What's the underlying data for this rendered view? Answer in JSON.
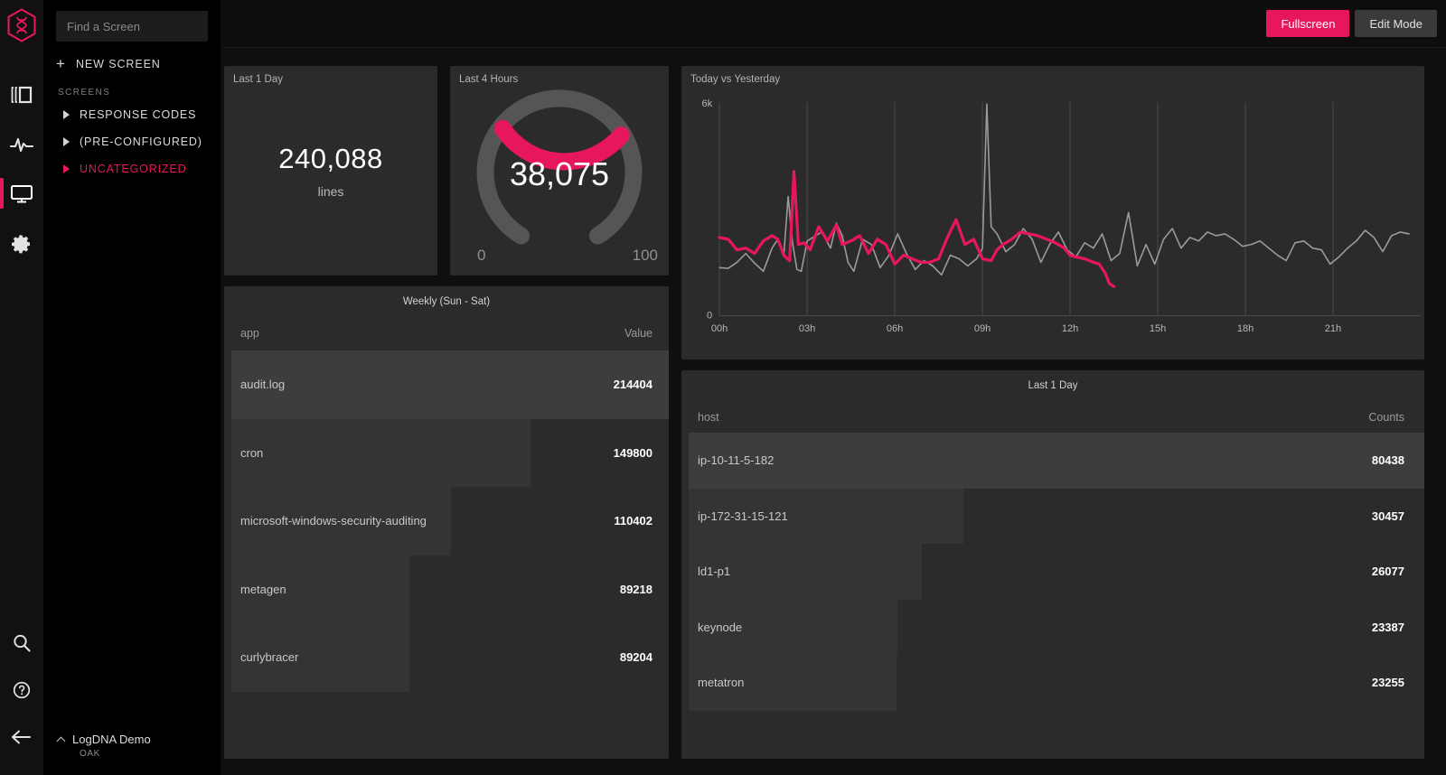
{
  "brand": {
    "accent": "#e8175d",
    "logo_icon": "dna-hexagon-logo"
  },
  "rail": {
    "items": [
      {
        "icon": "logs-view-icon",
        "name": "logs"
      },
      {
        "icon": "activity-pulse-icon",
        "name": "activity"
      },
      {
        "icon": "screen-monitor-icon",
        "name": "screens",
        "active": true
      },
      {
        "icon": "gear-icon",
        "name": "settings"
      }
    ],
    "bottom": [
      {
        "icon": "search-icon",
        "name": "search"
      },
      {
        "icon": "help-circle-icon",
        "name": "help"
      },
      {
        "icon": "collapse-arrow-left-icon",
        "name": "collapse"
      }
    ]
  },
  "sidebar": {
    "search": {
      "placeholder": "Find a Screen",
      "value": ""
    },
    "new_screen_label": "NEW SCREEN",
    "section_label": "SCREENS",
    "screens": [
      {
        "label": "RESPONSE CODES",
        "selected": false
      },
      {
        "label": "(PRE-CONFIGURED)",
        "selected": false
      },
      {
        "label": "UNCATEGORIZED",
        "selected": true
      }
    ],
    "org": {
      "name": "LogDNA Demo",
      "sub": "OAK"
    }
  },
  "topbar": {
    "fullscreen_label": "Fullscreen",
    "edit_mode_label": "Edit Mode"
  },
  "widgets": {
    "count": {
      "title": "Last 1 Day",
      "value": "240,088",
      "unit": "lines"
    },
    "gauge": {
      "title": "Last 4 Hours",
      "value": "38,075",
      "min": "0",
      "max": "100",
      "percent": 38
    },
    "apps": {
      "title": "Weekly (Sun - Sat)",
      "col_key": "app",
      "col_value": "Value",
      "rows": [
        {
          "key": "audit.log",
          "value": "214404",
          "pct": 100
        },
        {
          "key": "cron",
          "value": "149800",
          "pct": 69
        },
        {
          "key": "microsoft-windows-security-auditing",
          "value": "110402",
          "pct": 51
        },
        {
          "key": "metagen",
          "value": "89218",
          "pct": 41.6
        },
        {
          "key": "curlybracer",
          "value": "89204",
          "pct": 41.6
        }
      ]
    },
    "hosts": {
      "title": "Last 1 Day",
      "col_key": "host",
      "col_value": "Counts",
      "rows": [
        {
          "key": "ip-10-11-5-182",
          "value": "80438",
          "pct": 100
        },
        {
          "key": "ip-172-31-15-121",
          "value": "30457",
          "pct": 37.9
        },
        {
          "key": "ld1-p1",
          "value": "26077",
          "pct": 32.4
        },
        {
          "key": "keynode",
          "value": "23387",
          "pct": 29.1
        },
        {
          "key": "metatron",
          "value": "23255",
          "pct": 28.9
        }
      ]
    }
  },
  "chart_data": {
    "type": "line",
    "title": "Today vs Yesterday",
    "xlabel": "",
    "ylabel": "",
    "ylim": [
      0,
      6000
    ],
    "y_ticks": [
      "0",
      "6k"
    ],
    "grid": true,
    "legend": "none",
    "x_tick_labels": [
      "00h",
      "03h",
      "06h",
      "09h",
      "12h",
      "15h",
      "18h",
      "21h"
    ],
    "x_tick_hours": [
      0,
      3,
      6,
      9,
      12,
      15,
      18,
      21
    ],
    "series": [
      {
        "name": "Yesterday",
        "color": "#9a9a9a",
        "x": [
          0,
          0.3,
          0.6,
          0.9,
          1.2,
          1.5,
          1.8,
          2.0,
          2.2,
          2.35,
          2.5,
          2.65,
          2.8,
          3.0,
          3.2,
          3.5,
          3.8,
          4.0,
          4.2,
          4.4,
          4.6,
          4.9,
          5.2,
          5.5,
          5.8,
          6.1,
          6.4,
          6.7,
          7.0,
          7.3,
          7.6,
          7.9,
          8.2,
          8.5,
          8.8,
          9.0,
          9.15,
          9.3,
          9.5,
          9.8,
          10.1,
          10.4,
          10.7,
          11.0,
          11.3,
          11.6,
          11.9,
          12.2,
          12.5,
          12.8,
          13.1,
          13.4,
          13.7,
          14.0,
          14.3,
          14.6,
          14.9,
          15.2,
          15.5,
          15.8,
          16.1,
          16.4,
          16.7,
          17.0,
          17.3,
          17.6,
          17.9,
          18.2,
          18.5,
          18.8,
          19.1,
          19.4,
          19.7,
          20.0,
          20.3,
          20.6,
          20.9,
          21.2,
          21.5,
          21.8,
          22.1,
          22.4,
          22.7,
          23.0,
          23.3,
          23.6
        ],
        "y": [
          1350,
          1330,
          1500,
          1750,
          1480,
          1250,
          1900,
          2150,
          1700,
          3350,
          2050,
          1300,
          1250,
          2100,
          2200,
          2350,
          1900,
          2600,
          2250,
          1500,
          1250,
          2150,
          2000,
          1350,
          1700,
          2300,
          1750,
          1300,
          1550,
          1400,
          1150,
          1700,
          1600,
          1400,
          1600,
          1900,
          5950,
          2500,
          2300,
          1800,
          2000,
          2450,
          2150,
          1500,
          2000,
          2350,
          1850,
          1650,
          2050,
          1900,
          2300,
          1550,
          1750,
          2900,
          1400,
          2000,
          1450,
          2150,
          2450,
          1900,
          2200,
          2100,
          2350,
          2250,
          2300,
          2150,
          1950,
          2000,
          2100,
          1900,
          1700,
          1550,
          2050,
          2100,
          1900,
          1850,
          1450,
          1650,
          1900,
          2100,
          2400,
          2200,
          1800,
          2250,
          2350,
          2300
        ]
      },
      {
        "name": "Today",
        "color": "#e8175d",
        "x": [
          0,
          0.3,
          0.6,
          0.9,
          1.2,
          1.5,
          1.8,
          2.0,
          2.2,
          2.4,
          2.55,
          2.7,
          2.9,
          3.1,
          3.4,
          3.7,
          4.0,
          4.2,
          4.5,
          4.8,
          5.1,
          5.4,
          5.7,
          6.0,
          6.3,
          6.6,
          6.9,
          7.2,
          7.5,
          7.8,
          8.1,
          8.4,
          8.7,
          9.0,
          9.3,
          9.5,
          9.7,
          10.0,
          10.3,
          10.6,
          10.9,
          11.2,
          11.5,
          11.8,
          12.0,
          12.2,
          12.5,
          12.8,
          13.0,
          13.2,
          13.35,
          13.5
        ],
        "y": [
          2200,
          2150,
          1850,
          1900,
          1750,
          2100,
          2250,
          2150,
          1700,
          1550,
          4050,
          2000,
          2050,
          1850,
          2500,
          2100,
          2550,
          2000,
          2100,
          2250,
          1750,
          2150,
          2000,
          1450,
          1700,
          1600,
          1500,
          1500,
          1600,
          2200,
          2700,
          2000,
          2150,
          1600,
          1550,
          1850,
          2000,
          2150,
          2350,
          2300,
          2250,
          2150,
          2050,
          1900,
          1700,
          1650,
          1600,
          1500,
          1450,
          1200,
          900,
          820
        ]
      }
    ]
  }
}
